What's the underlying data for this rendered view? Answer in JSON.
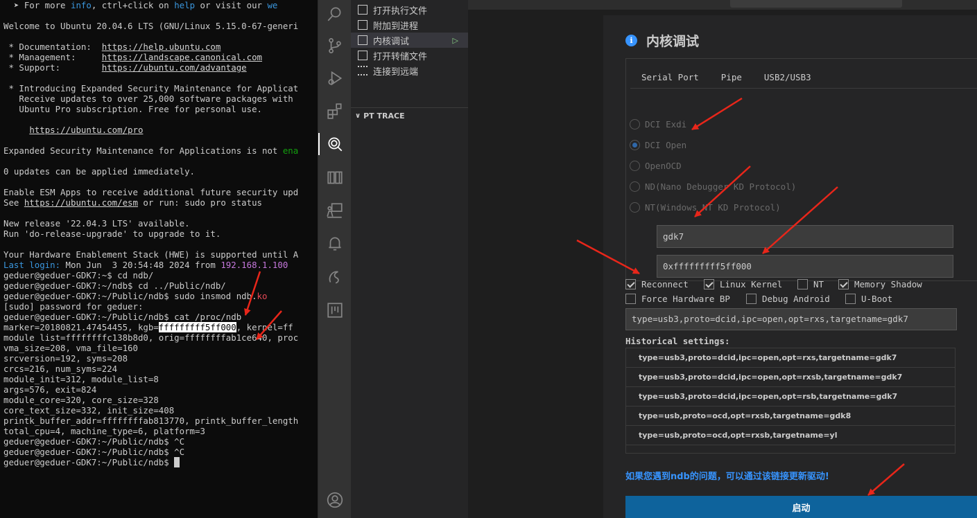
{
  "terminal": {
    "lines": [
      [
        {
          "t": "  ➤ For more "
        },
        {
          "t": "info",
          "c": "c-cyan"
        },
        {
          "t": ", ctrl+click on "
        },
        {
          "t": "help",
          "c": "c-cyan"
        },
        {
          "t": " or visit our "
        },
        {
          "t": "we",
          "c": "c-cyan"
        }
      ],
      [
        {
          "t": ""
        }
      ],
      [
        {
          "t": "Welcome to Ubuntu 20.04.6 LTS (GNU/Linux 5.15.0-67-generi"
        }
      ],
      [
        {
          "t": ""
        }
      ],
      [
        {
          "t": " * Documentation:  "
        },
        {
          "t": "https://help.ubuntu.com",
          "c": "c-link"
        }
      ],
      [
        {
          "t": " * Management:     "
        },
        {
          "t": "https://landscape.canonical.com",
          "c": "c-link"
        }
      ],
      [
        {
          "t": " * Support:        "
        },
        {
          "t": "https://ubuntu.com/advantage",
          "c": "c-link"
        }
      ],
      [
        {
          "t": ""
        }
      ],
      [
        {
          "t": " * Introducing Expanded Security Maintenance for Applicat"
        }
      ],
      [
        {
          "t": "   Receive updates to over 25,000 software packages with"
        }
      ],
      [
        {
          "t": "   Ubuntu Pro subscription. Free for personal use."
        }
      ],
      [
        {
          "t": ""
        }
      ],
      [
        {
          "t": "     "
        },
        {
          "t": "https://ubuntu.com/pro",
          "c": "c-link"
        }
      ],
      [
        {
          "t": ""
        }
      ],
      [
        {
          "t": "Expanded Security Maintenance for Applications is not "
        },
        {
          "t": "ena",
          "c": "c-green"
        }
      ],
      [
        {
          "t": ""
        }
      ],
      [
        {
          "t": "0 updates can be applied immediately."
        }
      ],
      [
        {
          "t": ""
        }
      ],
      [
        {
          "t": "Enable ESM Apps to receive additional future security upd"
        }
      ],
      [
        {
          "t": "See "
        },
        {
          "t": "https://ubuntu.com/esm",
          "c": "c-link"
        },
        {
          "t": " or run: sudo pro status"
        }
      ],
      [
        {
          "t": ""
        }
      ],
      [
        {
          "t": "New release '22.04.3 LTS' available."
        }
      ],
      [
        {
          "t": "Run 'do-release-upgrade' to upgrade to it."
        }
      ],
      [
        {
          "t": ""
        }
      ],
      [
        {
          "t": "Your Hardware Enablement Stack (HWE) is supported until A"
        }
      ],
      [
        {
          "t": "Last login:",
          "c": "c-cyan"
        },
        {
          "t": " Mon Jun  3 20:54:48 2024 from "
        },
        {
          "t": "192.168.1.100",
          "c": "c-mag"
        }
      ],
      [
        {
          "t": "geduer@geduer-GDK7:~$ cd ndb/"
        }
      ],
      [
        {
          "t": "geduer@geduer-GDK7:~/ndb$ cd ../Public/ndb/"
        }
      ],
      [
        {
          "t": "geduer@geduer-GDK7:~/Public/ndb$ sudo insmod ndb."
        },
        {
          "t": "ko",
          "c": "c-red"
        }
      ],
      [
        {
          "t": "[sudo] password for geduer:"
        }
      ],
      [
        {
          "t": "geduer@geduer-GDK7:~/Public/ndb$ cat /proc/ndb"
        }
      ],
      [
        {
          "t": "marker=20180821.47454455, kgb="
        },
        {
          "t": "fffffffff5ff000",
          "c": "c-hl"
        },
        {
          "t": ", kernel=ff"
        }
      ],
      [
        {
          "t": "module list=ffffffffc138b8d0, orig=ffffffffab1ce640, proc"
        }
      ],
      [
        {
          "t": "vma_size=208, vma_file=160"
        }
      ],
      [
        {
          "t": "srcversion=192, syms=208"
        }
      ],
      [
        {
          "t": "crcs=216, num_syms=224"
        }
      ],
      [
        {
          "t": "module_init=312, module_list=8"
        }
      ],
      [
        {
          "t": "args=576, exit=824"
        }
      ],
      [
        {
          "t": "module_core=320, core_size=328"
        }
      ],
      [
        {
          "t": "core_text_size=332, init_size=408"
        }
      ],
      [
        {
          "t": "printk_buffer_addr=ffffffffab813770, printk_buffer_length"
        }
      ],
      [
        {
          "t": "total_cpu=4, machine_type=6, platform=3"
        }
      ],
      [
        {
          "t": "geduer@geduer-GDK7:~/Public/ndb$ ^C"
        }
      ],
      [
        {
          "t": "geduer@geduer-GDK7:~/Public/ndb$ ^C"
        }
      ],
      [
        {
          "t": "geduer@geduer-GDK7:~/Public/ndb$ "
        },
        {
          "t": " ",
          "c": "cursor"
        }
      ]
    ]
  },
  "sidebar": {
    "items": [
      {
        "label": "打开执行文件"
      },
      {
        "label": "附加到进程"
      },
      {
        "label": "内核调试",
        "selected": true
      },
      {
        "label": "打开转储文件"
      },
      {
        "label": "连接到远端"
      }
    ],
    "run_icon": "▷",
    "pt_trace_label": "PT TRACE",
    "chevron": "∨"
  },
  "panel": {
    "info_glyph": "i",
    "title": "内核调试",
    "tabs": [
      {
        "label": "Serial Port"
      },
      {
        "label": "Pipe"
      },
      {
        "label": "USB2/USB3",
        "active": true
      }
    ],
    "radios": [
      {
        "label": "DCI Exdi",
        "checked": false
      },
      {
        "label": "DCI Open",
        "checked": true
      },
      {
        "label": "OpenOCD",
        "checked": false
      },
      {
        "label": "ND(Nano Debugger KD Protocol)",
        "checked": false
      },
      {
        "label": "NT(Windows NT KD Protocol)",
        "checked": false
      }
    ],
    "target_name": "gdk7",
    "address": "0xfffffffff5ff000",
    "checkboxes_row1": [
      {
        "label": "Reconnect",
        "checked": true
      },
      {
        "label": "Linux Kernel",
        "checked": true
      },
      {
        "label": "NT",
        "checked": false
      },
      {
        "label": "Memory Shadow",
        "checked": true
      }
    ],
    "checkboxes_row2": [
      {
        "label": "Force Hardware BP",
        "checked": false
      },
      {
        "label": "Debug Android",
        "checked": false
      },
      {
        "label": "U-Boot",
        "checked": false
      }
    ],
    "command_line": "type=usb3,proto=dcid,ipc=open,opt=rxs,targetname=gdk7",
    "history_label": "Historical settings:",
    "history": [
      "type=usb3,proto=dcid,ipc=open,opt=rxs,targetname=gdk7",
      "type=usb3,proto=dcid,ipc=open,opt=rxsb,targetname=gdk7",
      "type=usb3,proto=dcid,ipc=open,opt=rsb,targetname=gdk7",
      "type=usb,proto=ocd,opt=rxsb,targetname=gdk8",
      "type=usb,proto=ocd,opt=rxsb,targetname=yl"
    ],
    "driver_link": "如果您遇到ndb的问题，可以通过该链接更新驱动!",
    "start_label": "启动"
  },
  "colors": {
    "accent": "#3794ff",
    "button": "#0e639c",
    "arrow": "#e8261a"
  }
}
